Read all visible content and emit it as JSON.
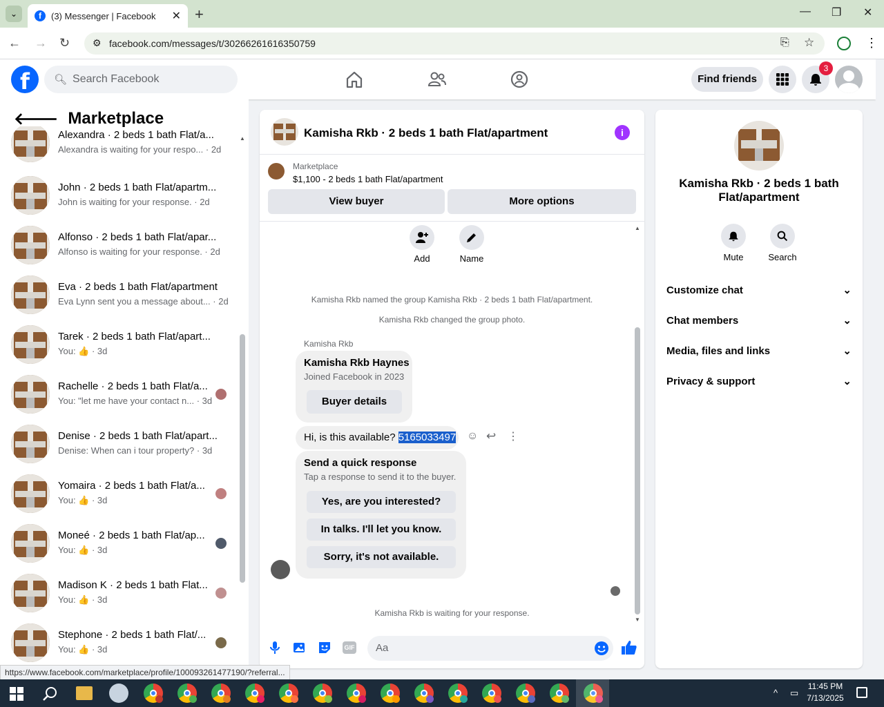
{
  "browser": {
    "tab_title": "(3) Messenger | Facebook",
    "url": "facebook.com/messages/t/30266261616350759"
  },
  "fb_header": {
    "search_placeholder": "Search Facebook",
    "find_friends": "Find friends",
    "notifications_count": "3"
  },
  "sidebar": {
    "title": "Marketplace",
    "conversations": [
      {
        "name": "Alexandra · 2 beds 1 bath Flat/a...",
        "preview": "Alexandra is waiting for your respo... · 2d"
      },
      {
        "name": "John · 2 beds 1 bath Flat/apartm...",
        "preview": "John is waiting for your response. · 2d"
      },
      {
        "name": "Alfonso · 2 beds 1 bath Flat/apar...",
        "preview": "Alfonso is waiting for your response. · 2d"
      },
      {
        "name": "Eva · 2 beds 1 bath Flat/apartment",
        "preview": "Eva Lynn sent you a message about... · 2d"
      },
      {
        "name": "Tarek · 2 beds 1 bath Flat/apart...",
        "preview": "You: 👍 · 3d"
      },
      {
        "name": "Rachelle · 2 beds 1 bath Flat/a...",
        "preview": "You: \"let me have your contact n... · 3d"
      },
      {
        "name": "Denise · 2 beds 1 bath Flat/apart...",
        "preview": "Denise: When can i tour property? · 3d"
      },
      {
        "name": "Yomaira · 2 beds 1 bath Flat/a...",
        "preview": "You: 👍 · 3d"
      },
      {
        "name": "Moneé · 2 beds 1 bath Flat/ap...",
        "preview": "You: 👍 · 3d"
      },
      {
        "name": "Madison K · 2 beds 1 bath Flat...",
        "preview": "You: 👍 · 3d"
      },
      {
        "name": "Stephone · 2 beds 1 bath Flat/...",
        "preview": "You: 👍 · 3d"
      }
    ]
  },
  "chat": {
    "title": "Kamisha Rkb · 2 beds 1 bath Flat/apartment",
    "marketplace_label": "Marketplace",
    "listing": "$1,100 - 2 beds 1 bath Flat/apartment",
    "view_buyer": "View buyer",
    "more_options": "More options",
    "add_label": "Add",
    "name_label": "Name",
    "sys1": "Kamisha Rkb named the group Kamisha Rkb · 2 beds 1 bath Flat/apartment.",
    "sys2": "Kamisha Rkb changed the group photo.",
    "sender": "Kamisha Rkb",
    "card_name": "Kamisha Rkb Haynes",
    "card_sub": "Joined Facebook in 2023",
    "buyer_details": "Buyer details",
    "message_text": "Hi, is this available? ",
    "message_selected": "5165033497",
    "quick_title": "Send a quick response",
    "quick_sub": "Tap a response to send it to the buyer.",
    "quick_1": "Yes, are you interested?",
    "quick_2": "In talks. I'll let you know.",
    "quick_3": "Sorry, it's not available.",
    "waiting": "Kamisha Rkb is waiting for your response.",
    "input_placeholder": "Aa"
  },
  "info_panel": {
    "title": "Kamisha Rkb · 2 beds 1 bath Flat/apartment",
    "mute": "Mute",
    "search": "Search",
    "sections": [
      "Customize chat",
      "Chat members",
      "Media, files and links",
      "Privacy & support"
    ]
  },
  "status_url": "https://www.facebook.com/marketplace/profile/100093261477190/?referral...",
  "clock": {
    "time": "11:45 PM",
    "date": "7/13/2025"
  }
}
